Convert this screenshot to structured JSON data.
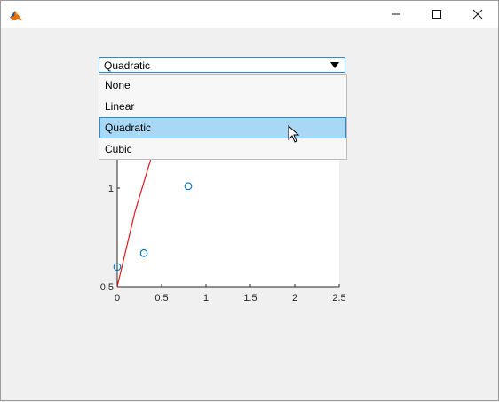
{
  "window": {
    "icon": "matlab-logo-icon",
    "controls": {
      "minimize": "minimize-icon",
      "maximize": "maximize-icon",
      "close": "close-icon"
    }
  },
  "dropdown": {
    "value": "Quadratic",
    "options": [
      "None",
      "Linear",
      "Quadratic",
      "Cubic"
    ],
    "selected_index": 2
  },
  "chart_data": {
    "type": "scatter",
    "xlim": [
      0,
      2.5
    ],
    "ylim": [
      0.5,
      1.5
    ],
    "x_ticks": [
      "0",
      "0.5",
      "1",
      "1.5",
      "2",
      "2.5"
    ],
    "y_ticks": [
      "0.5",
      "1"
    ],
    "series": [
      {
        "type": "scatter",
        "marker": "circle-open",
        "color": "#0072bd",
        "x": [
          0,
          0.3,
          0.8
        ],
        "y": [
          0.6,
          0.67,
          1.01
        ]
      },
      {
        "type": "line",
        "color": "#e31a1c",
        "x": [
          0,
          0.2,
          0.4,
          0.6,
          0.8
        ],
        "y": [
          0.5,
          0.88,
          1.18,
          1.4,
          1.54
        ]
      }
    ]
  }
}
